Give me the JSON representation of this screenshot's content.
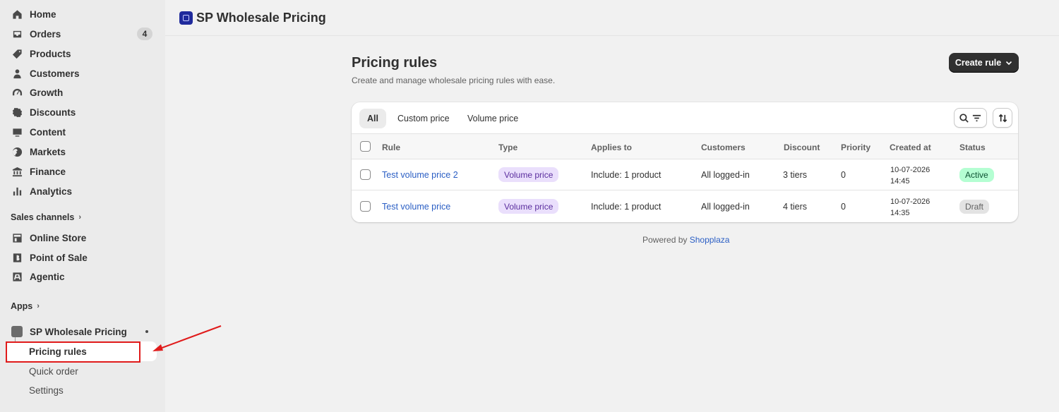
{
  "sidebar": {
    "nav": [
      {
        "label": "Home",
        "icon": "home-icon"
      },
      {
        "label": "Orders",
        "icon": "orders-icon",
        "badge": "4"
      },
      {
        "label": "Products",
        "icon": "tag-icon"
      },
      {
        "label": "Customers",
        "icon": "person-icon"
      },
      {
        "label": "Growth",
        "icon": "gauge-icon"
      },
      {
        "label": "Discounts",
        "icon": "discount-icon"
      },
      {
        "label": "Content",
        "icon": "content-icon"
      },
      {
        "label": "Markets",
        "icon": "globe-icon"
      },
      {
        "label": "Finance",
        "icon": "bank-icon"
      },
      {
        "label": "Analytics",
        "icon": "bar-chart-icon"
      }
    ],
    "sales_channels_label": "Sales channels",
    "channels": [
      {
        "label": "Online Store",
        "icon": "store-icon"
      },
      {
        "label": "Point of Sale",
        "icon": "pos-icon"
      },
      {
        "label": "Agentic",
        "icon": "agentic-icon"
      }
    ],
    "apps_label": "Apps",
    "app": {
      "label": "SP Wholesale Pricing"
    },
    "app_sub": [
      {
        "label": "Pricing rules"
      },
      {
        "label": "Quick order"
      },
      {
        "label": "Settings"
      }
    ]
  },
  "topbar": {
    "title": "SP Wholesale Pricing"
  },
  "page": {
    "title": "Pricing rules",
    "subtitle": "Create and manage wholesale pricing rules with ease.",
    "create_label": "Create rule"
  },
  "tabs": [
    "All",
    "Custom price",
    "Volume price"
  ],
  "table": {
    "headers": [
      "Rule",
      "Type",
      "Applies to",
      "Customers",
      "Discount",
      "Priority",
      "Created at",
      "Status"
    ],
    "rows": [
      {
        "rule": "Test volume price 2",
        "type": "Volume price",
        "applies": "Include: 1 product",
        "customers": "All logged-in",
        "discount": "3 tiers",
        "priority": "0",
        "date": "10-07-2026",
        "time": "14:45",
        "status": "Active"
      },
      {
        "rule": "Test volume price",
        "type": "Volume price",
        "applies": "Include: 1 product",
        "customers": "All logged-in",
        "discount": "4 tiers",
        "priority": "0",
        "date": "10-07-2026",
        "time": "14:35",
        "status": "Draft"
      }
    ]
  },
  "footer": {
    "powered_by": "Powered by",
    "brand": "Shopplaza"
  },
  "colors": {
    "accent": "#303030",
    "link": "#2a5ec4",
    "highlight": "#e01b1b"
  }
}
